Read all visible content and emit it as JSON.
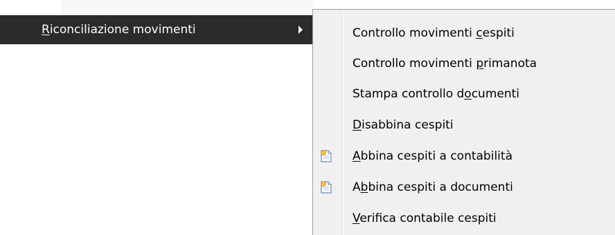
{
  "parent_menu": {
    "item_label_pre": "",
    "item_label_ul": "R",
    "item_label_post": "iconciliazione movimenti"
  },
  "submenu": {
    "items": [
      {
        "pre": "Controllo movimenti ",
        "ul": "c",
        "post": "espiti",
        "icon": null
      },
      {
        "pre": "Controllo movimenti ",
        "ul": "p",
        "post": "rimanota",
        "icon": null
      },
      {
        "pre": "Stampa controllo d",
        "ul": "o",
        "post": "cumenti",
        "icon": null
      },
      {
        "pre": "",
        "ul": "D",
        "post": "isabbina cespiti",
        "icon": null
      },
      {
        "pre": "",
        "ul": "A",
        "post": "bbina cespiti a contabilità",
        "icon": "document-star-icon"
      },
      {
        "pre": "A",
        "ul": "b",
        "post": "bina cespiti a documenti",
        "icon": "document-star-icon"
      },
      {
        "pre": "",
        "ul": "V",
        "post": "erifica contabile cespiti",
        "icon": null
      }
    ]
  },
  "colors": {
    "parent_highlight": "#2b2b2b",
    "menu_background": "#f0f0f0",
    "menu_border": "#9d9d9d"
  }
}
